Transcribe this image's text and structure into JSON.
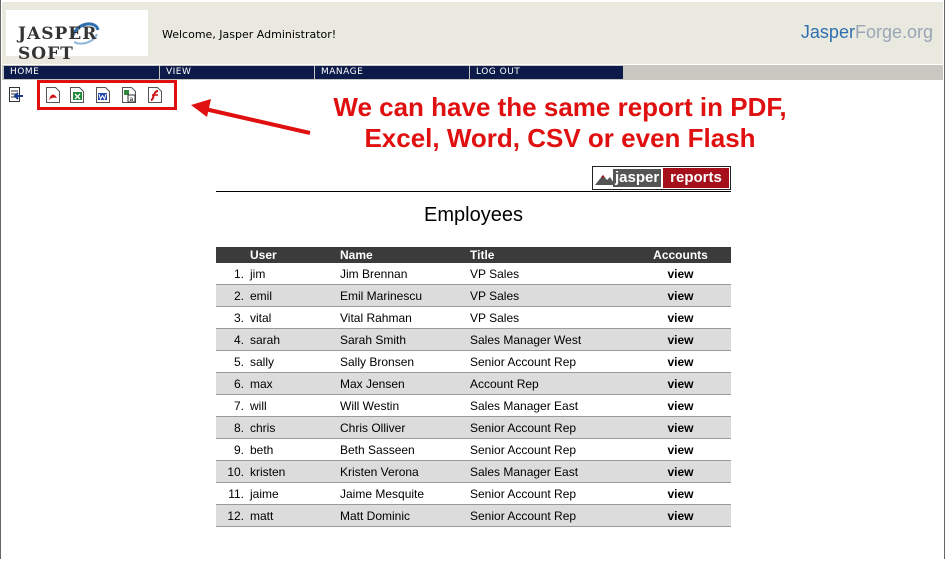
{
  "header": {
    "logo_text": "JASPER SOFT",
    "welcome": "Welcome, Jasper Administrator!",
    "forge_main": "Jasper",
    "forge_light": "Forge.org"
  },
  "nav": [
    {
      "label": "HOME"
    },
    {
      "label": "VIEW"
    },
    {
      "label": "MANAGE"
    },
    {
      "label": "LOG OUT"
    }
  ],
  "toolbar": {
    "icons": [
      "back-icon",
      "pdf-icon",
      "excel-icon",
      "word-icon",
      "csv-icon",
      "flash-icon"
    ]
  },
  "annotation": {
    "line1": "We can have the same report in PDF,",
    "line2": "Excel, Word, CSV or even Flash",
    "color": "#e01010"
  },
  "report": {
    "logo_left": "jasper",
    "logo_right": "reports",
    "title": "Employees",
    "columns": [
      "User",
      "Name",
      "Title",
      "Accounts"
    ],
    "rows": [
      {
        "num": "1.",
        "user": "jim",
        "name": "Jim Brennan",
        "title": "VP Sales",
        "accounts": "view"
      },
      {
        "num": "2.",
        "user": "emil",
        "name": "Emil Marinescu",
        "title": "VP Sales",
        "accounts": "view"
      },
      {
        "num": "3.",
        "user": "vital",
        "name": "Vital Rahman",
        "title": "VP Sales",
        "accounts": "view"
      },
      {
        "num": "4.",
        "user": "sarah",
        "name": "Sarah Smith",
        "title": "Sales Manager West",
        "accounts": "view"
      },
      {
        "num": "5.",
        "user": "sally",
        "name": "Sally Bronsen",
        "title": "Senior Account Rep",
        "accounts": "view"
      },
      {
        "num": "6.",
        "user": "max",
        "name": "Max Jensen",
        "title": "Account Rep",
        "accounts": "view"
      },
      {
        "num": "7.",
        "user": "will",
        "name": "Will Westin",
        "title": "Sales Manager East",
        "accounts": "view"
      },
      {
        "num": "8.",
        "user": "chris",
        "name": "Chris Olliver",
        "title": "Senior Account Rep",
        "accounts": "view"
      },
      {
        "num": "9.",
        "user": "beth",
        "name": "Beth Sasseen",
        "title": "Senior Account Rep",
        "accounts": "view"
      },
      {
        "num": "10.",
        "user": "kristen",
        "name": "Kristen Verona",
        "title": "Sales Manager East",
        "accounts": "view"
      },
      {
        "num": "11.",
        "user": "jaime",
        "name": "Jaime Mesquite",
        "title": "Senior Account Rep",
        "accounts": "view"
      },
      {
        "num": "12.",
        "user": "matt",
        "name": "Matt Dominic",
        "title": "Senior Account Rep",
        "accounts": "view"
      }
    ]
  }
}
